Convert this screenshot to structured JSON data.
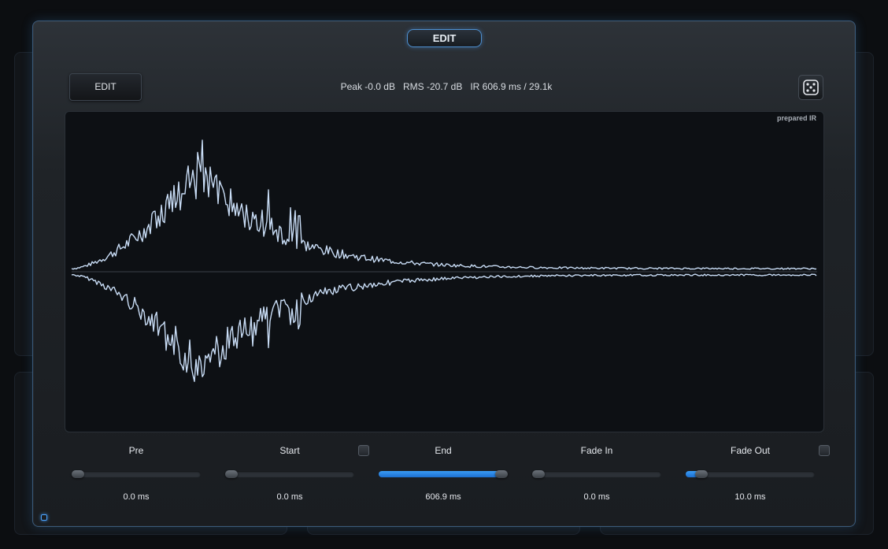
{
  "modal": {
    "tab_label": "EDIT",
    "edit_button_label": "EDIT",
    "stats": "Peak -0.0 dB   RMS -20.7 dB   IR 606.9 ms / 29.1k",
    "waveform_label": "prepared IR"
  },
  "controls": [
    {
      "label": "Pre",
      "value": "0.0 ms",
      "level": 0.0,
      "has_checkbox": false
    },
    {
      "label": "Start",
      "value": "0.0 ms",
      "level": 0.0,
      "has_checkbox": true
    },
    {
      "label": "End",
      "value": "606.9 ms",
      "level": 1.0,
      "has_checkbox": false
    },
    {
      "label": "Fade In",
      "value": "0.0 ms",
      "level": 0.0,
      "has_checkbox": false
    },
    {
      "label": "Fade Out",
      "value": "10.0 ms",
      "level": 0.08,
      "has_checkbox": true
    }
  ],
  "colors": {
    "accent": "#3a9cf5",
    "waveform": "#c8dcf5",
    "modal_border": "#3a5a7a"
  },
  "icons": {
    "dice": "dice-five-icon"
  }
}
